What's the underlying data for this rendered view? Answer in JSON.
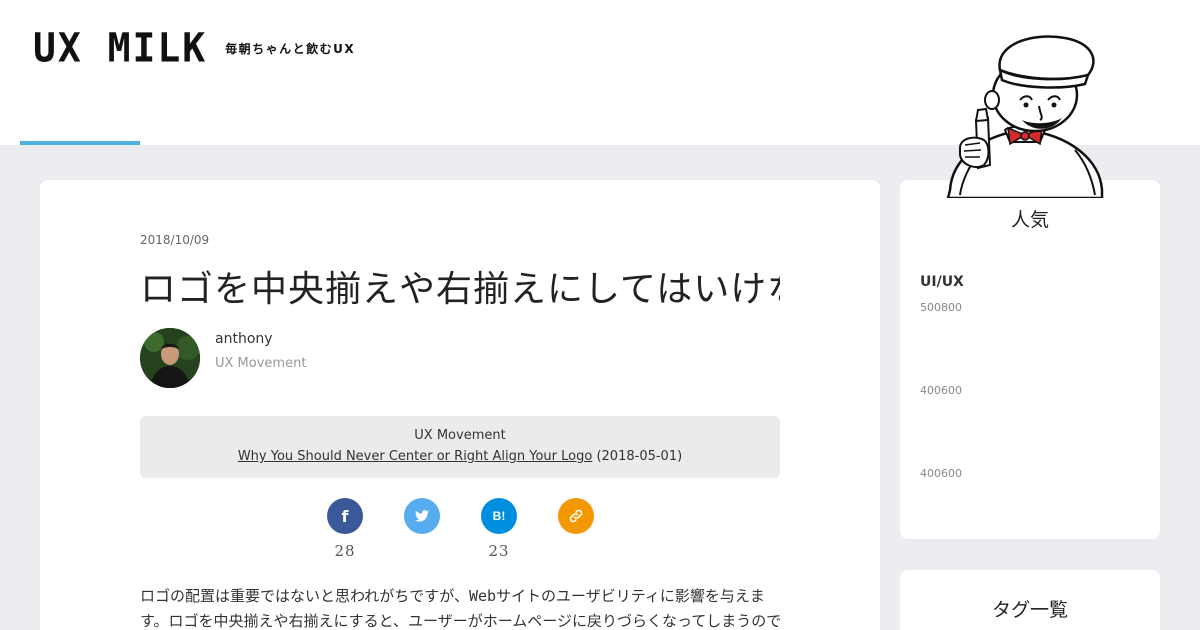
{
  "header": {
    "logo": "UX MILK",
    "tagline": "毎朝ちゃんと飲むUX"
  },
  "article": {
    "date": "2018/10/09",
    "title": "ロゴを中央揃えや右揃えにしてはいけない理由とは？",
    "author": {
      "name": "anthony",
      "source": "UX Movement"
    },
    "source_box": {
      "name": "UX Movement",
      "link_text": "Why You Should Never Center or Right Align Your Logo",
      "date": "(2018-05-01)"
    },
    "share": [
      {
        "name": "facebook",
        "icon": "facebook-icon",
        "count": "28",
        "color": "#3b5998"
      },
      {
        "name": "twitter",
        "icon": "twitter-icon",
        "count": "",
        "color": "#55acee"
      },
      {
        "name": "hatena",
        "icon": "hatena-bookmark-icon",
        "label": "B!",
        "count": "23",
        "color": "#008fde"
      },
      {
        "name": "link",
        "icon": "link-icon",
        "count": "",
        "color": "#f39800"
      }
    ],
    "intro": "ロゴの配置は重要ではないと思われがちですが、Webサイトのユーザビリティに影響を与えます。ロゴを中央揃えや右揃えにすると、ユーザーがホームページに戻りづらくなってしまうのです。"
  },
  "sidebar": {
    "ranking": {
      "title": "人気",
      "category": "UI/UX",
      "items": [
        "500800",
        "400600",
        "400600"
      ]
    },
    "second_widget": {
      "title": "タグ一覧"
    }
  },
  "colors": {
    "accent": "#4eb2dd",
    "background": "#ecedf0",
    "card": "#ffffff"
  }
}
